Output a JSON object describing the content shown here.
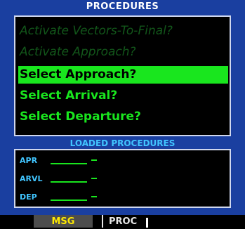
{
  "window": {
    "title": "PROCEDURES"
  },
  "menu": {
    "items": [
      {
        "label": "Activate Vectors-To-Final?",
        "state": "disabled"
      },
      {
        "label": "Activate Approach?",
        "state": "disabled"
      },
      {
        "label": "Select Approach?",
        "state": "selected"
      },
      {
        "label": "Select Arrival?",
        "state": "normal"
      },
      {
        "label": "Select Departure?",
        "state": "normal"
      }
    ]
  },
  "loaded": {
    "title": "LOADED PROCEDURES",
    "rows": [
      {
        "label": "APR"
      },
      {
        "label": "ARVL"
      },
      {
        "label": "DEP"
      }
    ]
  },
  "softkeys": {
    "msg": "MSG",
    "proc": "PROC"
  },
  "colors": {
    "background": "#1a3fa0",
    "green": "#19e61e",
    "cyan": "#41c5ff",
    "yellow": "#ffea00"
  }
}
